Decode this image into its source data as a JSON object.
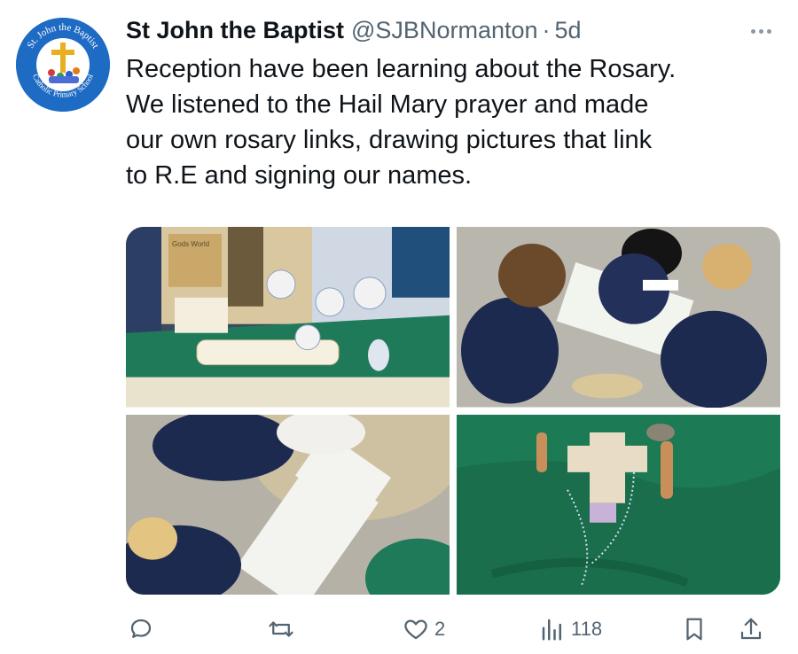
{
  "tweet": {
    "author_name": "St John the Baptist",
    "handle": "@SJBNormanton",
    "separator": "·",
    "time": "5d",
    "avatar_text_top": "St. John the Baptist",
    "avatar_text_bottom": "Catholic Primary School",
    "text_lines": [
      "Reception have been learning about the Rosary.",
      "We listened to the Hail Mary prayer and made",
      "our own rosary links, drawing pictures that link",
      "to R.E and signing our names."
    ]
  },
  "media": {
    "photos": [
      {
        "name": "classroom-display-photo"
      },
      {
        "name": "children-drawing-photo"
      },
      {
        "name": "children-coloring-photo"
      },
      {
        "name": "prayer-table-photo"
      }
    ],
    "photo1_sign_text": "Gods World"
  },
  "actions": {
    "reply_icon": "reply-icon",
    "retweet_icon": "retweet-icon",
    "like_icon": "heart-icon",
    "like_count": "2",
    "views_icon": "views-icon",
    "views_count": "118",
    "bookmark_icon": "bookmark-icon",
    "share_icon": "share-icon"
  },
  "colors": {
    "text": "#0f1419",
    "secondary": "#536471",
    "avatar_blue": "#1e6bc3",
    "table_green": "#1f7a5a"
  }
}
